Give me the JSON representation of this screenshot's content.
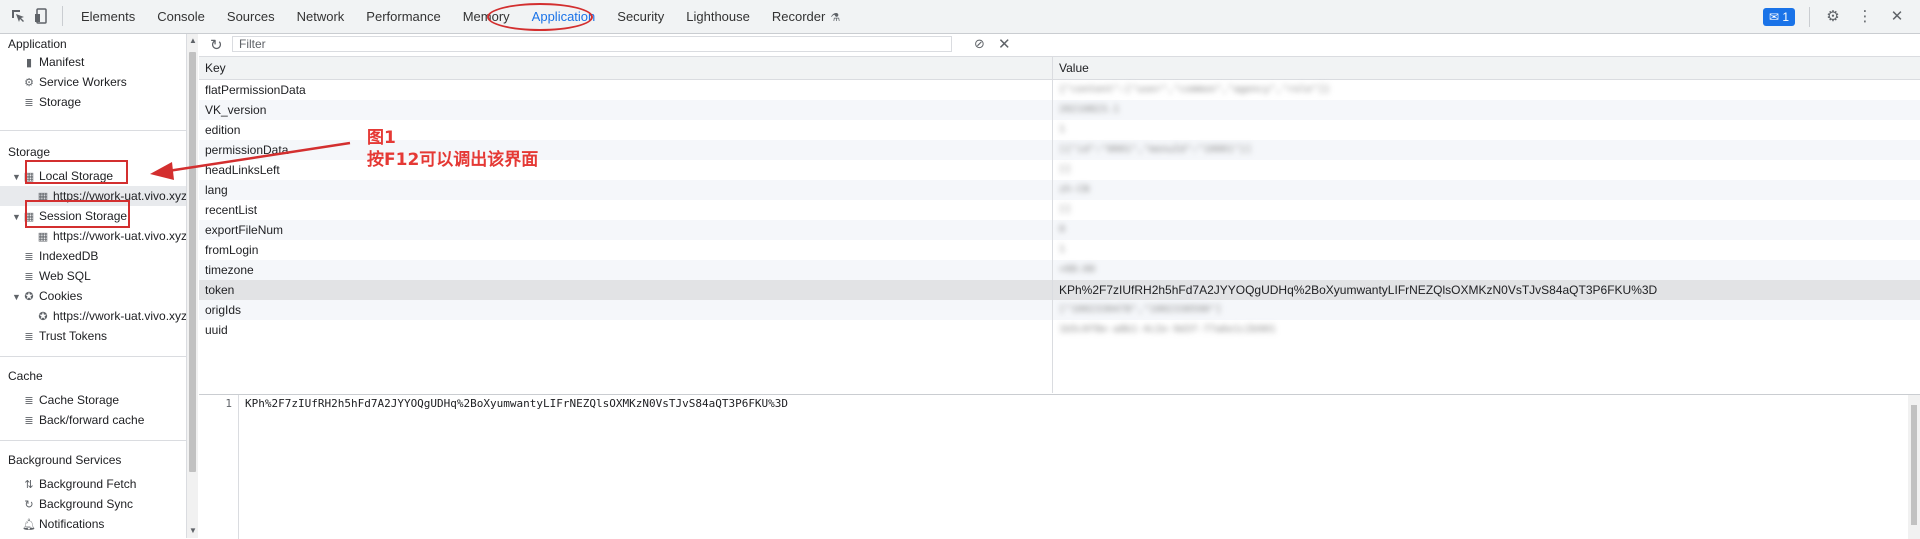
{
  "toolbar": {
    "tabs": [
      "Elements",
      "Console",
      "Sources",
      "Network",
      "Performance",
      "Memory",
      "Application",
      "Security",
      "Lighthouse",
      "Recorder"
    ],
    "selected_tab": "Application",
    "message_count": "1"
  },
  "sidebar": {
    "application_header": "Application",
    "application_items": [
      "Manifest",
      "Service Workers",
      "Storage"
    ],
    "storage_header": "Storage",
    "local_storage": "Local Storage",
    "local_storage_origin": "https://vwork-uat.vivo.xyz",
    "session_storage": "Session Storage",
    "session_storage_origin": "https://vwork-uat.vivo.xyz",
    "indexeddb": "IndexedDB",
    "websql": "Web SQL",
    "cookies": "Cookies",
    "cookies_origin": "https://vwork-uat.vivo.xyz",
    "trust_tokens": "Trust Tokens",
    "cache_header": "Cache",
    "cache_items": [
      "Cache Storage",
      "Back/forward cache"
    ],
    "bg_header": "Background Services",
    "bg_items": [
      "Background Fetch",
      "Background Sync",
      "Notifications"
    ]
  },
  "filter": {
    "placeholder": "Filter"
  },
  "grid": {
    "key_header": "Key",
    "value_header": "Value",
    "rows": [
      {
        "key": "flatPermissionData",
        "value": "{\"content\":[\"user\",\"common\",\"agency\",\"role\"]}"
      },
      {
        "key": "VK_version",
        "value": "20210823.1"
      },
      {
        "key": "edition",
        "value": "1"
      },
      {
        "key": "permissionData",
        "value": "[{\"id\":\"0001\",\"menuId\":\"10001\"}]"
      },
      {
        "key": "headLinksLeft",
        "value": "[]"
      },
      {
        "key": "lang",
        "value": "zh-CN"
      },
      {
        "key": "recentList",
        "value": "[]"
      },
      {
        "key": "exportFileNum",
        "value": "0"
      },
      {
        "key": "fromLogin",
        "value": "1"
      },
      {
        "key": "timezone",
        "value": "+08:00"
      },
      {
        "key": "token",
        "value": "KPh%2F7zIUfRH2h5hFd7A2JYYOQgUDHq%2BoXyumwantyLIFrNEZQlsOXMKzN0VsTJvS84aQT3P6FKU%3D"
      },
      {
        "key": "origIds",
        "value": "[\"1002330478\",\"1002330590\"]"
      },
      {
        "key": "uuid",
        "value": "1b5c0f8e-a8b1-4c2e-9d3f-77a6e1c2b901"
      }
    ],
    "selected_row": 10
  },
  "preview": {
    "line_number": "1",
    "content": "KPh%2F7zIUfRH2h5hFd7A2JYYOQgUDHq%2BoXyumwantyLIFrNEZQlsOXMKzN0VsTJvS84aQT3P6FKU%3D"
  },
  "annotation": {
    "title": "图1",
    "text": "按F12可以调出该界面",
    "color": "#e53935"
  }
}
